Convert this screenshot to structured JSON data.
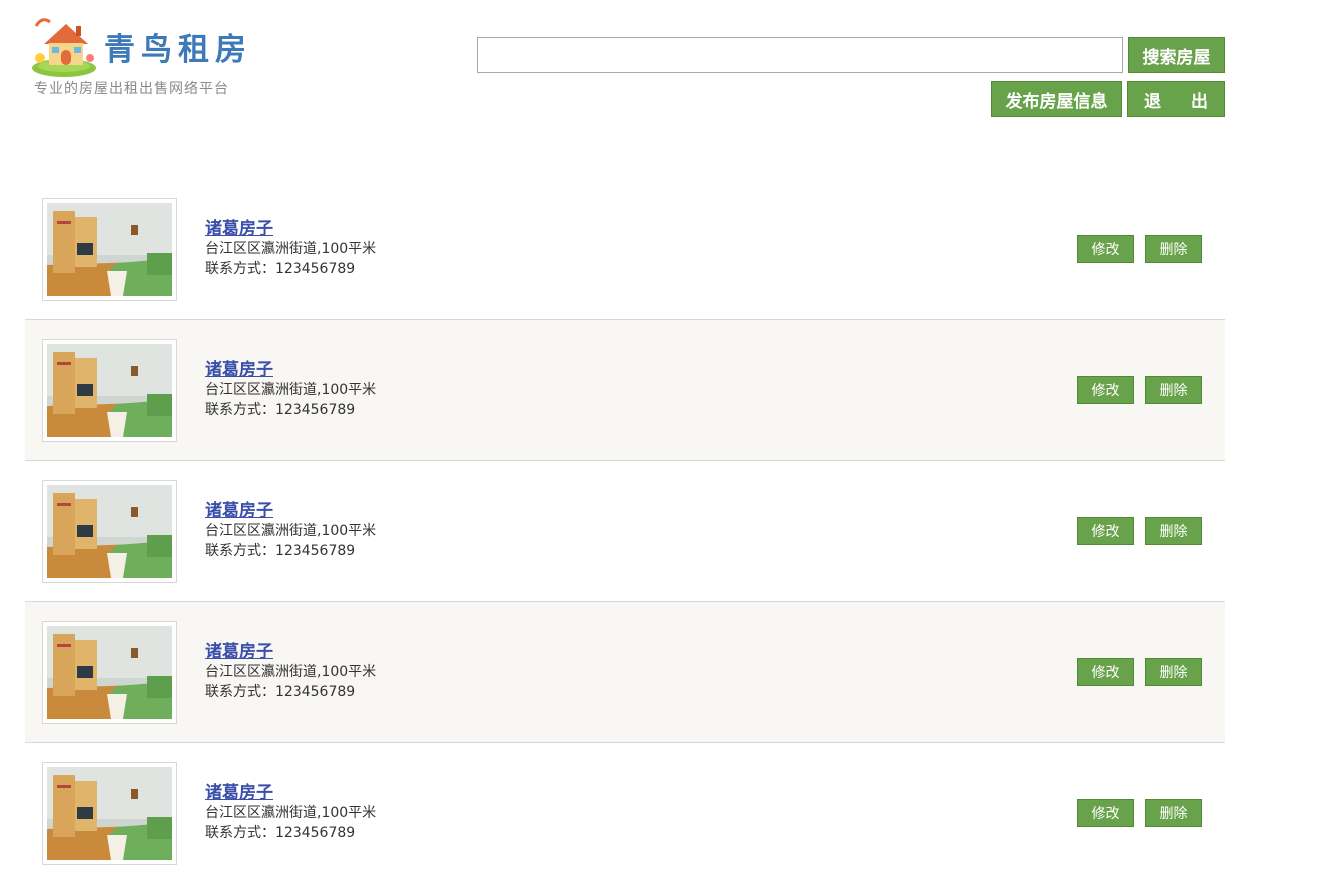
{
  "header": {
    "logo_title": "青鸟租房",
    "logo_slogan": "专业的房屋出租出售网络平台",
    "search_value": "",
    "search_button": "搜索房屋",
    "publish_button": "发布房屋信息",
    "exit_button": "退出"
  },
  "listings": [
    {
      "title": "诸葛房子",
      "address": "台江区区瀛洲街道,100平米",
      "contact": "联系方式：123456789",
      "edit": "修改",
      "delete": "删除"
    },
    {
      "title": "诸葛房子",
      "address": "台江区区瀛洲街道,100平米",
      "contact": "联系方式：123456789",
      "edit": "修改",
      "delete": "删除"
    },
    {
      "title": "诸葛房子",
      "address": "台江区区瀛洲街道,100平米",
      "contact": "联系方式：123456789",
      "edit": "修改",
      "delete": "删除"
    },
    {
      "title": "诸葛房子",
      "address": "台江区区瀛洲街道,100平米",
      "contact": "联系方式：123456789",
      "edit": "修改",
      "delete": "删除"
    },
    {
      "title": "诸葛房子",
      "address": "台江区区瀛洲街道,100平米",
      "contact": "联系方式：123456789",
      "edit": "修改",
      "delete": "删除"
    }
  ],
  "colors": {
    "accent_green": "#68a24a",
    "link_blue": "#3a4fa8",
    "logo_blue": "#3f7ab8",
    "alt_row_bg": "#f8f7f3"
  }
}
